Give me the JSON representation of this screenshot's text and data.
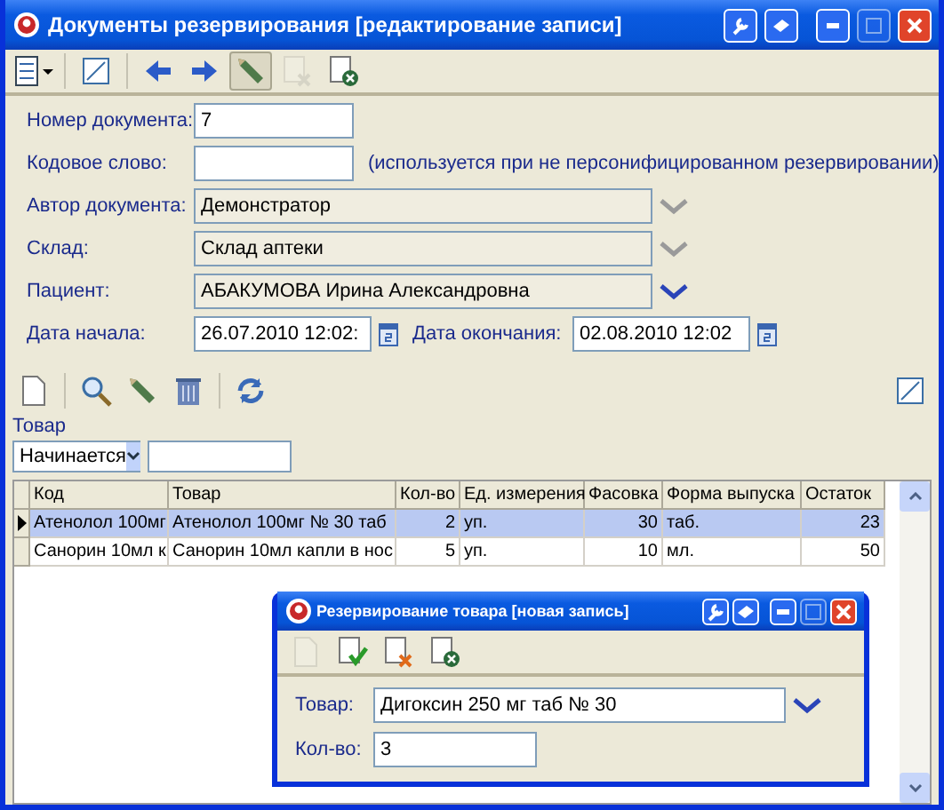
{
  "window": {
    "title": "Документы резервирования [редактирование записи]"
  },
  "toolbar": [
    {
      "kind": "columns",
      "disabled": false,
      "selected": false
    },
    {
      "kind": "separator"
    },
    {
      "kind": "resize",
      "disabled": false,
      "selected": false
    },
    {
      "kind": "separator"
    },
    {
      "kind": "prev",
      "disabled": false,
      "selected": false
    },
    {
      "kind": "next",
      "disabled": false,
      "selected": false
    },
    {
      "kind": "edit",
      "disabled": false,
      "selected": true
    },
    {
      "kind": "delete",
      "disabled": true,
      "selected": false
    },
    {
      "kind": "close",
      "disabled": false,
      "selected": false
    }
  ],
  "form": {
    "doc_number": {
      "label": "Номер документа:",
      "value": "7"
    },
    "code_word": {
      "label": "Кодовое слово:",
      "note": "(используется при не персонифицированном резервировании)"
    },
    "lookups": [
      {
        "label": "Автор документа:",
        "value": "Демонстратор",
        "active": false
      },
      {
        "label": "Склад:",
        "value": "Склад аптеки",
        "active": false
      },
      {
        "label": "Пациент:",
        "value": "АБАКУМОВА Ирина Александровна",
        "active": true
      }
    ],
    "start": {
      "label": "Дата начала:",
      "value": "26.07.2010 12:02:"
    },
    "end": {
      "label": "Дата окончания:",
      "value": "02.08.2010 12:02"
    }
  },
  "grid_toolbar": [
    {
      "kind": "new"
    },
    {
      "kind": "separator"
    },
    {
      "kind": "search"
    },
    {
      "kind": "edit"
    },
    {
      "kind": "trash"
    },
    {
      "kind": "separator"
    },
    {
      "kind": "refresh"
    }
  ],
  "filter": {
    "label": "Товар",
    "mode": "Начинается"
  },
  "table": {
    "columns": [
      "Код",
      "Товар",
      "Кол-во",
      "Ед. измерения",
      "Фасовка",
      "Форма выпуска",
      "Остаток"
    ],
    "rows": [
      {
        "selected": true,
        "cells": [
          "Атенолол 100мг",
          "Атенолол 100мг № 30 таб",
          "2",
          "уп.",
          "30",
          "таб.",
          "23"
        ]
      },
      {
        "selected": false,
        "cells": [
          "Санорин 10мл к",
          "Санорин 10мл капли в нос",
          "5",
          "уп.",
          "10",
          "мл.",
          "50"
        ]
      }
    ]
  },
  "dialog": {
    "title": "Резервирование товара [новая запись]",
    "toolbar": [
      {
        "kind": "new",
        "disabled": true
      },
      {
        "kind": "save",
        "disabled": false
      },
      {
        "kind": "cancel",
        "disabled": false
      },
      {
        "kind": "close",
        "disabled": false
      }
    ],
    "product": {
      "label": "Товар:",
      "value": "Дигоксин 250 мг таб № 30"
    },
    "qty": {
      "label": "Кол-во:",
      "value": "3"
    }
  }
}
